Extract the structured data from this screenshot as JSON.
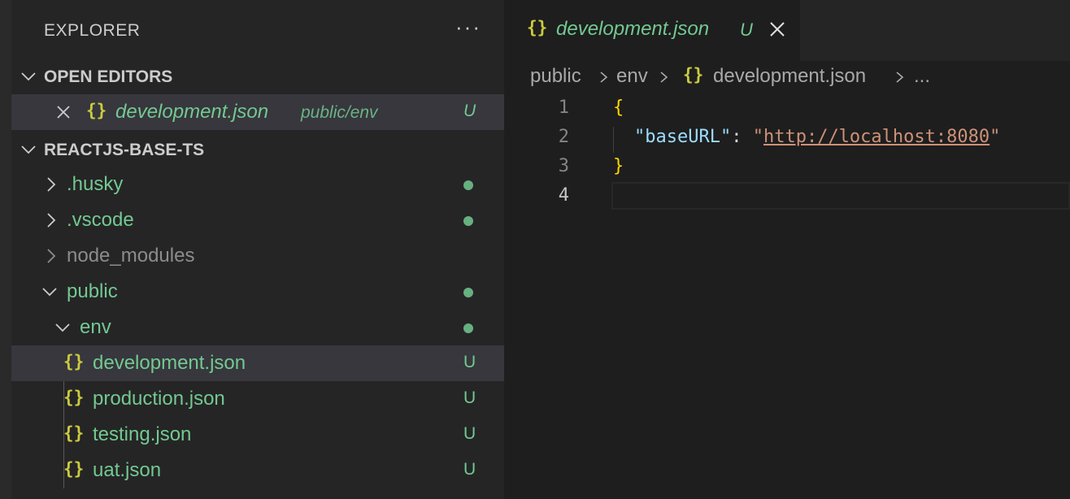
{
  "explorer": {
    "title": "EXPLORER",
    "more_label": "···"
  },
  "open_editors": {
    "label": "OPEN EDITORS",
    "items": [
      {
        "name": "development.json",
        "path": "public/env",
        "badge": "U"
      }
    ]
  },
  "project": {
    "label": "REACTJS-BASE-TS",
    "tree": [
      {
        "name": ".husky"
      },
      {
        "name": ".vscode"
      },
      {
        "name": "node_modules"
      },
      {
        "name": "public"
      },
      {
        "name": "env"
      },
      {
        "name": "development.json",
        "badge": "U"
      },
      {
        "name": "production.json",
        "badge": "U"
      },
      {
        "name": "testing.json",
        "badge": "U"
      },
      {
        "name": "uat.json",
        "badge": "U"
      }
    ]
  },
  "tab": {
    "label": "development.json",
    "badge": "U"
  },
  "breadcrumb": [
    "public",
    "env",
    "development.json",
    "..."
  ],
  "editor": {
    "line_numbers": [
      "1",
      "2",
      "3",
      "4"
    ],
    "lines": {
      "open_brace": "{",
      "key": "\"baseURL\"",
      "colon": ": ",
      "quote_open": "\"",
      "url": "http://localhost:8080",
      "quote_close": "\"",
      "close_brace": "}"
    }
  },
  "json_icon": "{}",
  "colors": {
    "untracked": "#73c991",
    "json_icon": "#cbcb41",
    "string": "#ce9178",
    "key": "#9cdcfe",
    "brace": "#ffd700"
  }
}
